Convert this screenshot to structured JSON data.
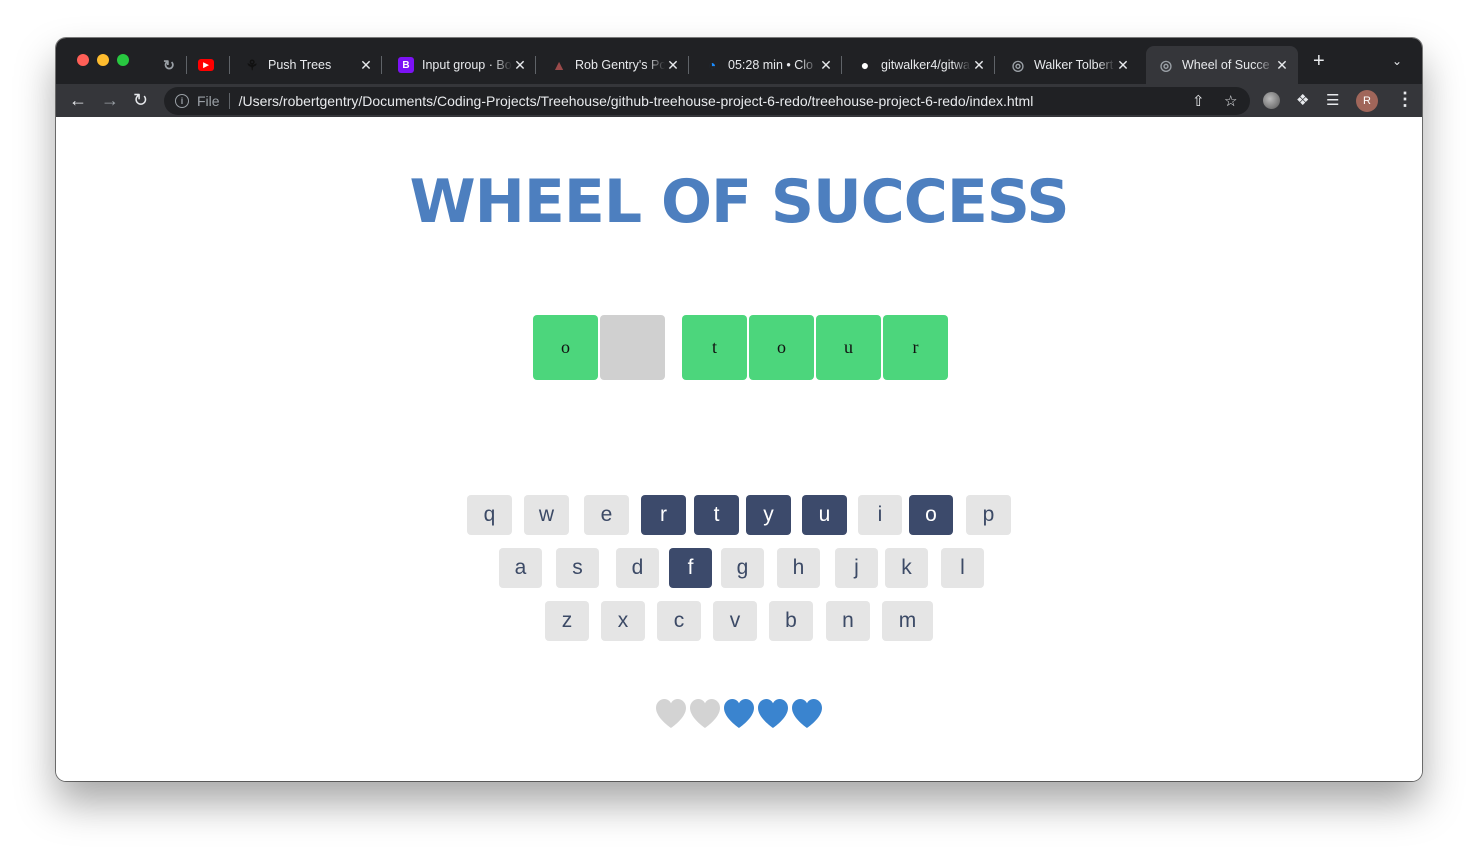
{
  "browser": {
    "tabs": [
      {
        "title": "",
        "favicon": "codepen-style-icon",
        "color": "#9aa0a6"
      },
      {
        "title": "",
        "favicon": "youtube-icon",
        "color": "#ff0000"
      },
      {
        "title": "Push Trees",
        "favicon": "tree-icon",
        "color": "#111111"
      },
      {
        "title": "Input group · Bo",
        "favicon": "bootstrap-icon",
        "color": "#7c12f5"
      },
      {
        "title": "Rob Gentry's Po",
        "favicon": "portfolio-icon",
        "color": "#9a4a4a"
      },
      {
        "title": "05:28 min • Clo",
        "favicon": "clock-icon",
        "color": "#1a8cff"
      },
      {
        "title": "gitwalker4/gitwa",
        "favicon": "github-icon",
        "color": "#ffffff"
      },
      {
        "title": "Walker Tolbert |",
        "favicon": "globe-icon",
        "color": "#9aa0a6"
      },
      {
        "title": "Wheel of Succe",
        "favicon": "globe-icon",
        "color": "#9aa0a6",
        "active": true
      }
    ],
    "address": {
      "scheme_label": "File",
      "url": "/Users/robertgentry/Documents/Coding-Projects/Treehouse/github-treehouse-project-6-redo/treehouse-project-6-redo/index.html"
    },
    "avatar_initial": "R"
  },
  "game": {
    "title": "WHEEL OF SUCCESS",
    "phrase": [
      {
        "char": "o",
        "shown": true
      },
      {
        "char": "",
        "shown": false
      },
      {
        "char": "t",
        "shown": true
      },
      {
        "char": "o",
        "shown": true
      },
      {
        "char": "u",
        "shown": true
      },
      {
        "char": "r",
        "shown": true
      }
    ],
    "keyboard": {
      "row1": [
        {
          "key": "q",
          "chosen": false
        },
        {
          "key": "w",
          "chosen": false
        },
        {
          "key": "e",
          "chosen": false
        },
        {
          "key": "r",
          "chosen": true
        },
        {
          "key": "t",
          "chosen": true
        },
        {
          "key": "y",
          "chosen": true
        },
        {
          "key": "u",
          "chosen": true
        },
        {
          "key": "i",
          "chosen": false
        },
        {
          "key": "o",
          "chosen": true
        },
        {
          "key": "p",
          "chosen": false
        }
      ],
      "row2": [
        {
          "key": "a",
          "chosen": false
        },
        {
          "key": "s",
          "chosen": false
        },
        {
          "key": "d",
          "chosen": false
        },
        {
          "key": "f",
          "chosen": true
        },
        {
          "key": "g",
          "chosen": false
        },
        {
          "key": "h",
          "chosen": false
        },
        {
          "key": "j",
          "chosen": false
        },
        {
          "key": "k",
          "chosen": false
        },
        {
          "key": "l",
          "chosen": false
        }
      ],
      "row3": [
        {
          "key": "z",
          "chosen": false
        },
        {
          "key": "x",
          "chosen": false
        },
        {
          "key": "c",
          "chosen": false
        },
        {
          "key": "v",
          "chosen": false
        },
        {
          "key": "b",
          "chosen": false
        },
        {
          "key": "n",
          "chosen": false
        },
        {
          "key": "m",
          "chosen": false
        }
      ]
    },
    "lives": {
      "total": 5,
      "lost": 2,
      "lost_color": "#d3d3d3",
      "live_color": "#3a84cf"
    },
    "colors": {
      "title": "#4d7fbf",
      "revealed_tile": "#4cd67c",
      "hidden_tile": "#d0d0d0",
      "key": "#e5e5e5",
      "chosen_key": "#3c4a6b"
    }
  }
}
